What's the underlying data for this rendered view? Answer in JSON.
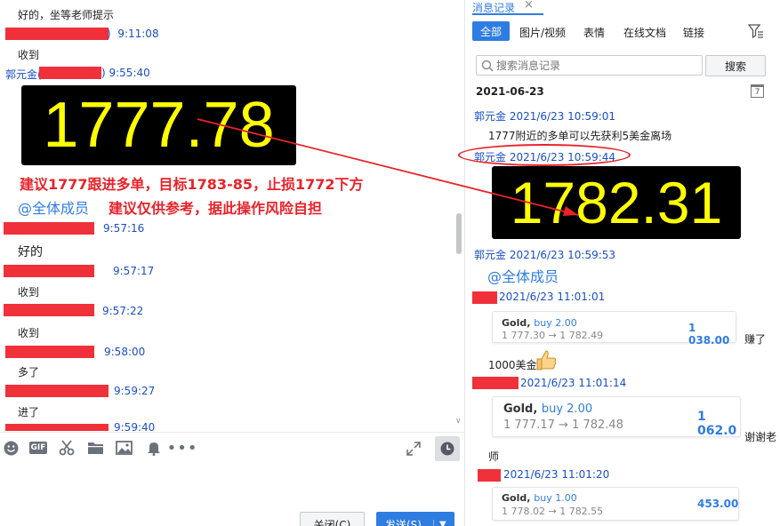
{
  "left_chat": {
    "messages": [
      {
        "text": "好的，坐等老师提示"
      },
      {
        "time": "9:11:08"
      },
      {
        "text": "收到"
      },
      {
        "sender": "郭元金(",
        "time": ")  9:55:40"
      },
      {
        "price": "1777.78"
      },
      {
        "text": "建议1777跟进多单，目标1783-85，止损1772下方"
      },
      {
        "mention": "@全体成员",
        "text": "建议仅供参考，据此操作风险自担"
      },
      {
        "time": "9:57:16"
      },
      {
        "text": "好的"
      },
      {
        "time": "9:57:17"
      },
      {
        "text": "收到"
      },
      {
        "time": "9:57:22"
      },
      {
        "text": "收到"
      },
      {
        "time": "9:58:00"
      },
      {
        "text": "多了"
      },
      {
        "time": "9:59:27"
      },
      {
        "text": "进了"
      },
      {
        "time": "9:59:40"
      }
    ],
    "toolbar_icons": [
      "emoji-icon",
      "gif-icon",
      "scissors-icon",
      "folder-icon",
      "image-icon",
      "bell-icon",
      "more-icon"
    ],
    "gif_label": "GIF",
    "close_button": "关闭(C)",
    "send_button": "发送(S)"
  },
  "history": {
    "tab_title": "消息记录",
    "filters": [
      "全部",
      "图片/视频",
      "表情",
      "在线文档",
      "链接"
    ],
    "search_placeholder": "搜索消息记录",
    "search_button": "搜索",
    "date": "2021-06-23",
    "calendar_day": "7",
    "entries": [
      {
        "header": "郭元金 2021/6/23 10:59:01",
        "text": "1777附近的多单可以先获利5美金离场"
      },
      {
        "header": "郭元金 2021/6/23 10:59:44",
        "price": "1782.31"
      },
      {
        "header": "郭元金 2021/6/23 10:59:53",
        "mention": "@全体成员"
      },
      {
        "header": "2021/6/23 11:01:01",
        "card": {
          "instrument": "Gold,",
          "side": "buy 2.00",
          "range": "1 777.30 → 1 782.49",
          "amount": "1 038.00"
        },
        "after": "赚了",
        "text": "1000美金"
      },
      {
        "header": "2021/6/23 11:01:14",
        "card": {
          "instrument": "Gold,",
          "side": "buy 2.00",
          "range": "1 777.17 → 1 782.48",
          "amount": "1 062.0"
        },
        "after": "谢谢老",
        "text": "师"
      },
      {
        "header": "2021/6/23 11:01:20",
        "card": {
          "instrument": "Gold,",
          "side": "buy 1.00",
          "range": "1 778.02 → 1 782.55",
          "amount": "453.00"
        }
      }
    ]
  },
  "colors": {
    "redaction": "#f0313a",
    "accent": "#2f7de1",
    "timestamp": "#1a4fc4",
    "annotation_red": "#e8232a",
    "price_yellow": "#ffff00"
  }
}
